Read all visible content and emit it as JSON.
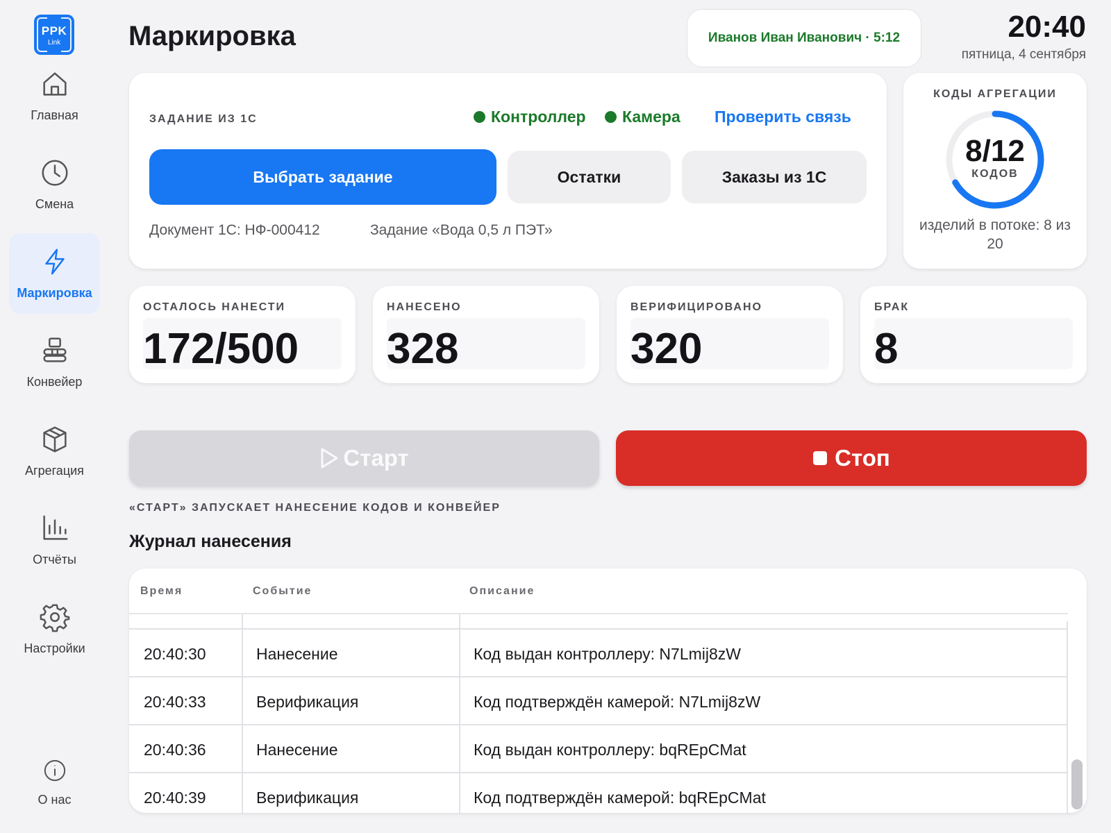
{
  "app": {
    "logo_line1": "PPK",
    "logo_line2": "Link"
  },
  "sidebar": {
    "items": [
      {
        "label": "Главная",
        "icon": "home-icon"
      },
      {
        "label": "Смена",
        "icon": "clock-icon"
      },
      {
        "label": "Маркировка",
        "icon": "lightning-icon",
        "active": true
      },
      {
        "label": "Конвейер",
        "icon": "conveyor-icon"
      },
      {
        "label": "Агрегация",
        "icon": "box-icon"
      },
      {
        "label": "Отчёты",
        "icon": "chart-icon"
      },
      {
        "label": "Настройки",
        "icon": "gear-icon"
      }
    ],
    "about": {
      "label": "О нас",
      "icon": "info-icon"
    }
  },
  "header": {
    "title": "Маркировка",
    "user": "Иванов Иван Иванович · 5:12",
    "time": "20:40",
    "date": "пятница, 4 сентября"
  },
  "task": {
    "caption": "ЗАДАНИЕ ИЗ 1С",
    "controller_status": "Контроллер",
    "camera_status": "Камера",
    "check_link": "Проверить связь",
    "select_button": "Выбрать задание",
    "leftovers_button": "Остатки",
    "orders_button": "Заказы из 1С",
    "document": "Документ 1С: НФ-000412",
    "task_name": "Задание «Вода 0,5 л ПЭТ»"
  },
  "aggregation": {
    "caption": "КОДЫ АГРЕГАЦИИ",
    "value": "8/12",
    "unit": "КОДОВ",
    "progress": 0.6667,
    "footer": "изделий в потоке: 8 из 20"
  },
  "stats": [
    {
      "caption": "ОСТАЛОСЬ НАНЕСТИ",
      "value": "172/500"
    },
    {
      "caption": "НАНЕСЕНО",
      "value": "328"
    },
    {
      "caption": "ВЕРИФИЦИРОВАНО",
      "value": "320"
    },
    {
      "caption": "БРАК",
      "value": "8"
    }
  ],
  "actions": {
    "start": "Старт",
    "stop": "Стоп",
    "hint": "«СТАРТ» ЗАПУСКАЕТ НАНЕСЕНИЕ КОДОВ И КОНВЕЙЕР"
  },
  "log": {
    "title": "Журнал нанесения",
    "columns": [
      "Время",
      "Событие",
      "Описание"
    ],
    "rows": [
      {
        "time": "20:40:30",
        "event": "Нанесение",
        "desc": "Код выдан контроллеру: N7Lmij8zW"
      },
      {
        "time": "20:40:33",
        "event": "Верификация",
        "desc": "Код подтверждён камерой: N7Lmij8zW"
      },
      {
        "time": "20:40:36",
        "event": "Нанесение",
        "desc": "Код выдан контроллеру: bqREpCMat"
      },
      {
        "time": "20:40:39",
        "event": "Верификация",
        "desc": "Код подтверждён камерой: bqREpCMat"
      }
    ]
  },
  "colors": {
    "accent": "#1877f2",
    "success": "#1b7a2a",
    "danger": "#d92d27",
    "disabled": "#d7d7dc"
  }
}
